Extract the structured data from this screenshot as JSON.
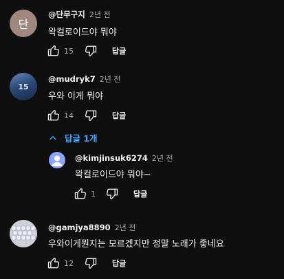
{
  "colors": {
    "background": "#0f0f0f",
    "text": "#f1f1f1",
    "muted": "#aaaaaa",
    "link": "#3ea6ff"
  },
  "reply_label": "답글",
  "comments": [
    {
      "author": "@단무구지",
      "time": "2년 전",
      "text": "왁컬로이드야 뭐야",
      "likes": "15",
      "avatar_text": "단",
      "avatar_color": "#a1887f"
    },
    {
      "author": "@mudryk7",
      "time": "2년 전",
      "text": "우와 이게 뭐야",
      "likes": "14",
      "avatar_text": "15",
      "avatar_color": "#2a4a7a"
    },
    {
      "author": "@gamjya8890",
      "time": "2년 전",
      "text": "우와이게뭔지는 모르겠지만 정말 노래가 좋네요",
      "likes": "12",
      "avatar_color": "#c8c8d0"
    }
  ],
  "replies_toggle": {
    "label": "답글 1개",
    "icon": "chevron-up-icon"
  },
  "reply": {
    "author": "@kimjinsuk6274",
    "time": "2년 전",
    "text": "왁컬로이드야 뭐야~",
    "likes": "1",
    "avatar_color": "#8aa4ff"
  }
}
